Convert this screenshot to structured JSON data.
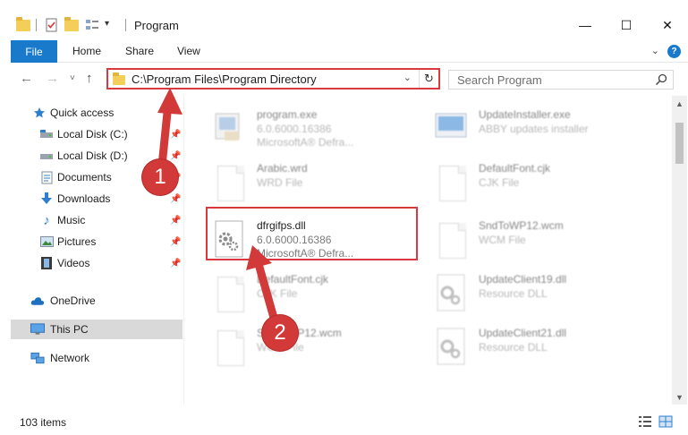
{
  "window": {
    "title": "Program",
    "minimize": "—",
    "maximize": "☐",
    "close": "✕"
  },
  "ribbon": {
    "file_tab": "File",
    "tabs": [
      "Home",
      "Share",
      "View"
    ]
  },
  "address": {
    "path": "C:\\Program Files\\Program Directory",
    "search_placeholder": "Search Program"
  },
  "nav_pane": {
    "items": [
      {
        "label": "Quick access",
        "icon": "star-icon",
        "pinned": false
      },
      {
        "label": "Local Disk (C:)",
        "icon": "drive-icon",
        "pinned": true
      },
      {
        "label": "Local Disk (D:)",
        "icon": "drive-icon",
        "pinned": true
      },
      {
        "label": "Documents",
        "icon": "documents-icon",
        "pinned": true
      },
      {
        "label": "Downloads",
        "icon": "download-icon",
        "pinned": true
      },
      {
        "label": "Music",
        "icon": "music-icon",
        "pinned": true
      },
      {
        "label": "Pictures",
        "icon": "pictures-icon",
        "pinned": true
      },
      {
        "label": "Videos",
        "icon": "videos-icon",
        "pinned": true
      },
      {
        "label": "OneDrive",
        "icon": "cloud-icon",
        "pinned": false
      },
      {
        "label": "This PC",
        "icon": "computer-icon",
        "pinned": false,
        "selected": true
      },
      {
        "label": "Network",
        "icon": "network-icon",
        "pinned": false
      }
    ]
  },
  "files": [
    {
      "name": "program.exe",
      "line2": "6.0.6000.16386",
      "line3": "MicrosoftA® Defra...",
      "icon": "exe-icon",
      "blurred": true
    },
    {
      "name": "UpdateInstaller.exe",
      "line2": "ABBY updates installer",
      "line3": "",
      "icon": "installer-icon",
      "blurred": true
    },
    {
      "name": "Arabic.wrd",
      "line2": "WRD File",
      "line3": "",
      "icon": "document-icon",
      "blurred": true
    },
    {
      "name": "DefaultFont.cjk",
      "line2": "CJK File",
      "line3": "",
      "icon": "document-icon",
      "blurred": true
    },
    {
      "name": "dfrgifps.dll",
      "line2": "6.0.6000.16386",
      "line3": "MicrosoftA® Defra...",
      "icon": "dll-gear-icon",
      "blurred": false
    },
    {
      "name": "SndToWP12.wcm",
      "line2": "WCM File",
      "line3": "",
      "icon": "document-icon",
      "blurred": true
    },
    {
      "name": "DefaultFont.cjk",
      "line2": "CJK File",
      "line3": "",
      "icon": "document-icon",
      "blurred": true
    },
    {
      "name": "UpdateClient19.dll",
      "line2": "Resource DLL",
      "line3": "",
      "icon": "dll-gear-icon",
      "blurred": true
    },
    {
      "name": "SndToWP12.wcm",
      "line2": "WCM File",
      "line3": "",
      "icon": "document-icon",
      "blurred": true
    },
    {
      "name": "UpdateClient21.dll",
      "line2": "Resource DLL",
      "line3": "",
      "icon": "dll-gear-icon",
      "blurred": true
    }
  ],
  "status": {
    "item_count": "103 items"
  },
  "annotations": {
    "step1": "1",
    "step2": "2",
    "color": "#d23a3a"
  }
}
